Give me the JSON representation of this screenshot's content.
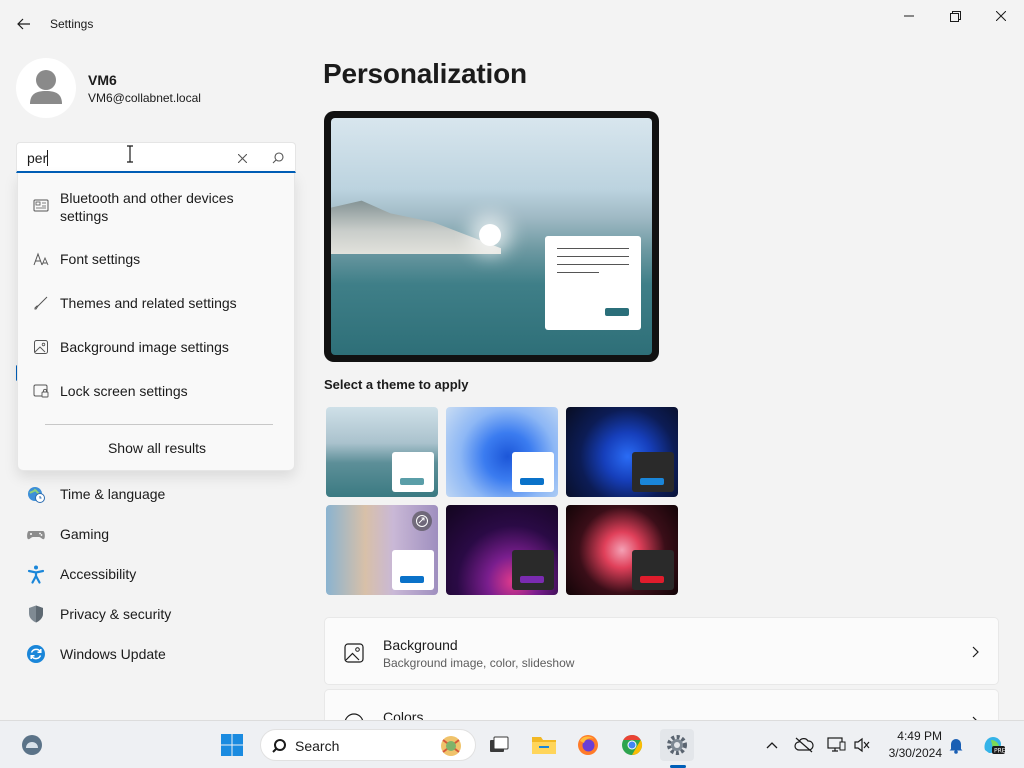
{
  "window": {
    "title": "Settings"
  },
  "profile": {
    "name": "VM6",
    "email": "VM6@collabnet.local"
  },
  "search": {
    "value": "per"
  },
  "suggestions": {
    "items": [
      {
        "label": "Bluetooth and other devices settings",
        "icon": "devices-icon"
      },
      {
        "label": "Font settings",
        "icon": "font-icon"
      },
      {
        "label": "Themes and related settings",
        "icon": "brush-icon"
      },
      {
        "label": "Background image settings",
        "icon": "image-icon"
      },
      {
        "label": "Lock screen settings",
        "icon": "lock-screen-icon"
      }
    ],
    "show_all": "Show all results"
  },
  "nav": {
    "items": [
      {
        "label": "Time & language",
        "icon": "globe-clock-icon"
      },
      {
        "label": "Gaming",
        "icon": "gamepad-icon"
      },
      {
        "label": "Accessibility",
        "icon": "accessibility-icon"
      },
      {
        "label": "Privacy & security",
        "icon": "shield-icon"
      },
      {
        "label": "Windows Update",
        "icon": "update-icon"
      }
    ]
  },
  "main": {
    "title": "Personalization",
    "themes_label": "Select a theme to apply",
    "cards": [
      {
        "title": "Background",
        "subtitle": "Background image, color, slideshow"
      },
      {
        "title": "Colors"
      }
    ]
  },
  "taskbar": {
    "search_label": "Search",
    "time": "4:49 PM",
    "date": "3/30/2024"
  },
  "colors": {
    "accent": "#005fb8"
  }
}
